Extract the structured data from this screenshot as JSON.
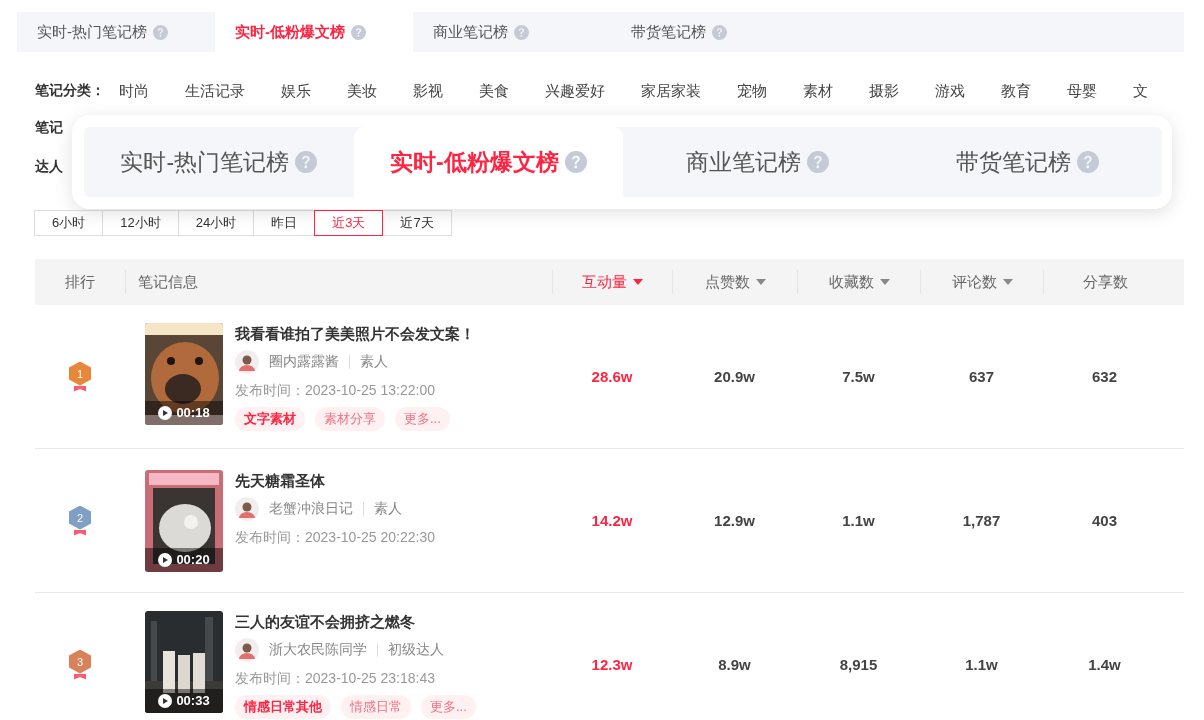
{
  "tabs": [
    {
      "label": "实时-热门笔记榜",
      "selected": false
    },
    {
      "label": "实时-低粉爆文榜",
      "selected": true
    },
    {
      "label": "商业笔记榜",
      "selected": false
    },
    {
      "label": "带货笔记榜",
      "selected": false
    }
  ],
  "filters": {
    "label": "笔记分类：",
    "categories": [
      "时尚",
      "生活记录",
      "娱乐",
      "美妆",
      "影视",
      "美食",
      "兴趣爱好",
      "家居家装",
      "宠物",
      "素材",
      "摄影",
      "游戏",
      "教育",
      "母婴",
      "文"
    ],
    "covered_labels": [
      "笔记",
      "达人"
    ]
  },
  "zoom_callout": {
    "tabs": [
      {
        "label": "实时-热门笔记榜",
        "selected": false
      },
      {
        "label": "实时-低粉爆文榜",
        "selected": true
      },
      {
        "label": "商业笔记榜",
        "selected": false
      },
      {
        "label": "带货笔记榜",
        "selected": false
      }
    ]
  },
  "time_ranges": [
    {
      "label": "6小时",
      "selected": false
    },
    {
      "label": "12小时",
      "selected": false
    },
    {
      "label": "24小时",
      "selected": false
    },
    {
      "label": "昨日",
      "selected": false
    },
    {
      "label": "近3天",
      "selected": true
    },
    {
      "label": "近7天",
      "selected": false
    }
  ],
  "table": {
    "columns": [
      {
        "label": "排行",
        "sortable": false,
        "selected": false
      },
      {
        "label": "笔记信息",
        "sortable": false,
        "selected": false
      },
      {
        "label": "互动量",
        "sortable": true,
        "selected": true
      },
      {
        "label": "点赞数",
        "sortable": true,
        "selected": false
      },
      {
        "label": "收藏数",
        "sortable": true,
        "selected": false
      },
      {
        "label": "评论数",
        "sortable": true,
        "selected": false
      },
      {
        "label": "分享数",
        "sortable": false,
        "selected": false
      }
    ],
    "rows": [
      {
        "rank": "1",
        "color": "#e8863a",
        "title": "我看看谁拍了美美照片不会发文案！",
        "duration": "00:18",
        "author": "圈内露露酱",
        "level": "素人",
        "published": "发布时间：2023-10-25 13:22:00",
        "tags": [
          {
            "label": "文字素材",
            "highlight": true
          },
          {
            "label": "素材分享",
            "highlight": false
          },
          {
            "label": "更多...",
            "highlight": false
          }
        ],
        "interactions": "28.6w",
        "likes": "20.9w",
        "favorites": "7.5w",
        "comments": "637",
        "shares": "632"
      },
      {
        "rank": "2",
        "color": "#7f9fc4",
        "title": "先天糖霜圣体",
        "duration": "00:20",
        "author": "老蟹冲浪日记",
        "level": "素人",
        "published": "发布时间：2023-10-25 20:22:30",
        "interactions": "14.2w",
        "likes": "12.9w",
        "favorites": "1.1w",
        "comments": "1,787",
        "shares": "403"
      },
      {
        "rank": "3",
        "color": "#d98259",
        "title": "三人的友谊不会拥挤之燃冬",
        "duration": "00:33",
        "author": "浙大农民陈同学",
        "level": "初级达人",
        "published": "发布时间：2023-10-25 23:18:43",
        "tags": [
          {
            "label": "情感日常其他",
            "highlight": true
          },
          {
            "label": "情感日常",
            "highlight": false
          },
          {
            "label": "更多...",
            "highlight": false
          }
        ],
        "interactions": "12.3w",
        "likes": "8.9w",
        "favorites": "8,915",
        "comments": "1.1w",
        "shares": "1.4w"
      }
    ]
  }
}
